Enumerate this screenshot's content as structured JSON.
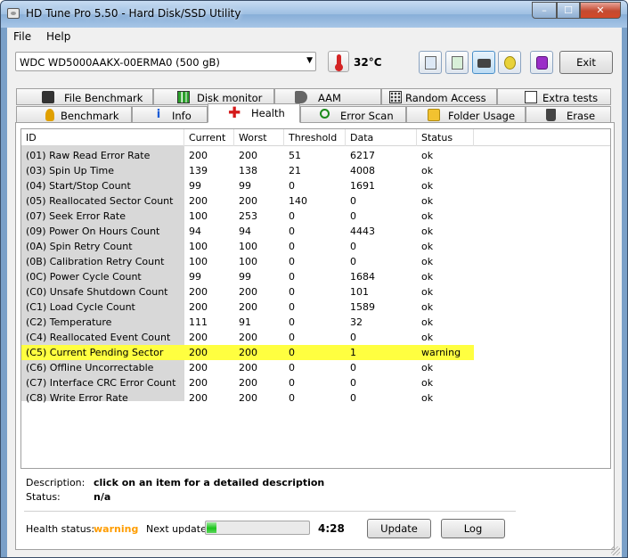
{
  "window": {
    "title": "HD Tune Pro 5.50 - Hard Disk/SSD Utility",
    "min_icon": "minimize-icon",
    "max_icon": "maximize-icon",
    "close_icon": "close-icon"
  },
  "menu": {
    "file": "File",
    "help": "Help"
  },
  "toolbar": {
    "drive": "WDC WD5000AAKX-00ERMA0 (500 gB)",
    "temperature": "32°C",
    "exit": "Exit",
    "icons": [
      "copy-text-icon",
      "copy-screen-icon",
      "screenshot-camera-icon",
      "options-icon",
      "save-down-icon"
    ]
  },
  "tabs_row1": [
    "File Benchmark",
    "Disk monitor",
    "AAM",
    "Random Access",
    "Extra tests"
  ],
  "tabs_row2": [
    "Benchmark",
    "Info",
    "Health",
    "Error Scan",
    "Folder Usage",
    "Erase"
  ],
  "selected_tab": "Health",
  "table": {
    "headers": [
      "ID",
      "Current",
      "Worst",
      "Threshold",
      "Data",
      "Status"
    ],
    "rows": [
      [
        "(01) Raw Read Error Rate",
        "200",
        "200",
        "51",
        "6217",
        "ok"
      ],
      [
        "(03) Spin Up Time",
        "139",
        "138",
        "21",
        "4008",
        "ok"
      ],
      [
        "(04) Start/Stop Count",
        "99",
        "99",
        "0",
        "1691",
        "ok"
      ],
      [
        "(05) Reallocated Sector Count",
        "200",
        "200",
        "140",
        "0",
        "ok"
      ],
      [
        "(07) Seek Error Rate",
        "100",
        "253",
        "0",
        "0",
        "ok"
      ],
      [
        "(09) Power On Hours Count",
        "94",
        "94",
        "0",
        "4443",
        "ok"
      ],
      [
        "(0A) Spin Retry Count",
        "100",
        "100",
        "0",
        "0",
        "ok"
      ],
      [
        "(0B) Calibration Retry Count",
        "100",
        "100",
        "0",
        "0",
        "ok"
      ],
      [
        "(0C) Power Cycle Count",
        "99",
        "99",
        "0",
        "1684",
        "ok"
      ],
      [
        "(C0) Unsafe Shutdown Count",
        "200",
        "200",
        "0",
        "101",
        "ok"
      ],
      [
        "(C1) Load Cycle Count",
        "200",
        "200",
        "0",
        "1589",
        "ok"
      ],
      [
        "(C2) Temperature",
        "111",
        "91",
        "0",
        "32",
        "ok"
      ],
      [
        "(C4) Reallocated Event Count",
        "200",
        "200",
        "0",
        "0",
        "ok"
      ],
      [
        "(C5) Current Pending Sector",
        "200",
        "200",
        "0",
        "1",
        "warning"
      ],
      [
        "(C6) Offline Uncorrectable",
        "200",
        "200",
        "0",
        "0",
        "ok"
      ],
      [
        "(C7) Interface CRC Error Count",
        "200",
        "200",
        "0",
        "0",
        "ok"
      ],
      [
        "(C8) Write Error Rate",
        "200",
        "200",
        "0",
        "0",
        "ok"
      ]
    ]
  },
  "details": {
    "description_label": "Description:",
    "description_value": "click on an item for a detailed description",
    "status_label": "Status:",
    "status_value": "n/a",
    "health_label": "Health status:",
    "health_value": "warning",
    "next_update_label": "Next update:",
    "progress_fraction": 0.1,
    "countdown": "4:28",
    "update_button": "Update",
    "log_button": "Log"
  },
  "colors": {
    "warning_row": "#ffff40",
    "health_warning_text": "#ff9d00"
  }
}
